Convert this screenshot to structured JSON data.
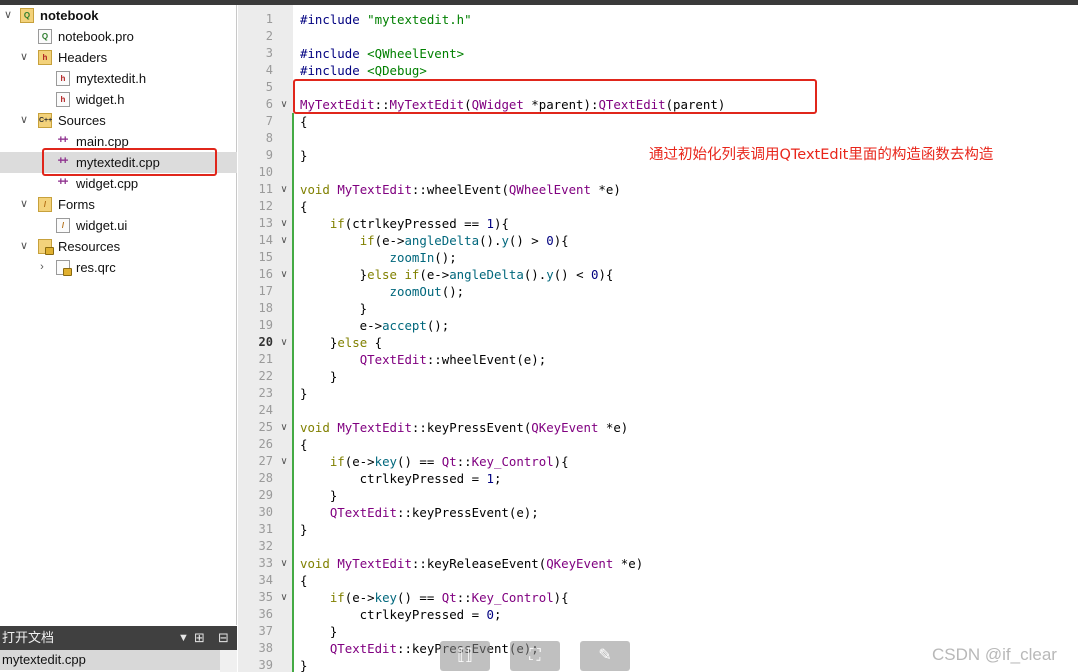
{
  "project_tree": {
    "project": "notebook",
    "pro_file": "notebook.pro",
    "headers_label": "Headers",
    "headers": [
      "mytextedit.h",
      "widget.h"
    ],
    "sources_label": "Sources",
    "sources": [
      "main.cpp",
      "mytextedit.cpp",
      "widget.cpp"
    ],
    "forms_label": "Forms",
    "forms": [
      "widget.ui"
    ],
    "resources_label": "Resources",
    "resources": [
      "res.qrc"
    ]
  },
  "open_documents": {
    "title": "打开文档",
    "items": [
      "mytextedit.cpp"
    ]
  },
  "editor": {
    "annotation": "通过初始化列表调用QTextEdit里面的构造函数去构造",
    "current_line": 20,
    "lines": [
      "#include \"mytextedit.h\"",
      "",
      "#include <QWheelEvent>",
      "#include <QDebug>",
      "",
      "MyTextEdit::MyTextEdit(QWidget *parent):QTextEdit(parent)",
      "{",
      "",
      "}",
      "",
      "void MyTextEdit::wheelEvent(QWheelEvent *e)",
      "{",
      "    if(ctrlkeyPressed == 1){",
      "        if(e->angleDelta().y() > 0){",
      "            zoomIn();",
      "        }else if(e->angleDelta().y() < 0){",
      "            zoomOut();",
      "        }",
      "        e->accept();",
      "    }else {",
      "        QTextEdit::wheelEvent(e);",
      "    }",
      "}",
      "",
      "void MyTextEdit::keyPressEvent(QKeyEvent *e)",
      "{",
      "    if(e->key() == Qt::Key_Control){",
      "        ctrlkeyPressed = 1;",
      "    }",
      "    QTextEdit::keyPressEvent(e);",
      "}",
      "",
      "void MyTextEdit::keyReleaseEvent(QKeyEvent *e)",
      "{",
      "    if(e->key() == Qt::Key_Control){",
      "        ctrlkeyPressed = 0;",
      "    }",
      "    QTextEdit::keyPressEvent(e);",
      "}"
    ]
  },
  "watermark": "CSDN @if_clear",
  "colors": {
    "keyword": "#808000",
    "type": "#800080",
    "string": "#008000",
    "function": "#00677c",
    "number": "#000080",
    "highlight_box": "#e0261b"
  }
}
